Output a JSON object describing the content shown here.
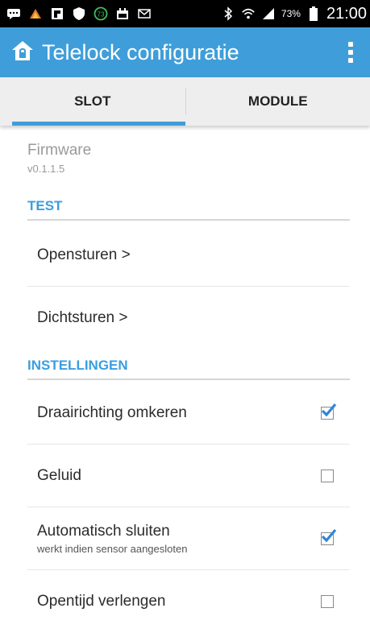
{
  "status_bar": {
    "icons": [
      "message-icon",
      "app-icon",
      "flipboard-icon",
      "shield-icon",
      "badge-icon",
      "calendar-icon",
      "mail-icon",
      "bluetooth-icon",
      "wifi-icon",
      "signal-icon"
    ],
    "badge_number": "73",
    "battery_percent": "73%",
    "time": "21:00"
  },
  "app_bar": {
    "title": "Telelock configuratie"
  },
  "tabs": [
    {
      "label": "SLOT",
      "active": true
    },
    {
      "label": "MODULE",
      "active": false
    }
  ],
  "firmware": {
    "title": "Firmware",
    "version": "v0.1.1.5"
  },
  "sections": {
    "test": "TEST",
    "settings": "INSTELLINGEN"
  },
  "actions": {
    "open": "Opensturen >",
    "close": "Dichtsturen >"
  },
  "settings": [
    {
      "label": "Draairichting omkeren",
      "checked": true
    },
    {
      "label": "Geluid",
      "checked": false
    },
    {
      "label": "Automatisch sluiten",
      "sublabel": "werkt indien sensor aangesloten",
      "checked": true
    },
    {
      "label": "Opentijd verlengen",
      "checked": false
    }
  ],
  "colors": {
    "accent": "#3f9ed9",
    "section_text": "#3a9ee0",
    "check": "#2f86d6"
  }
}
